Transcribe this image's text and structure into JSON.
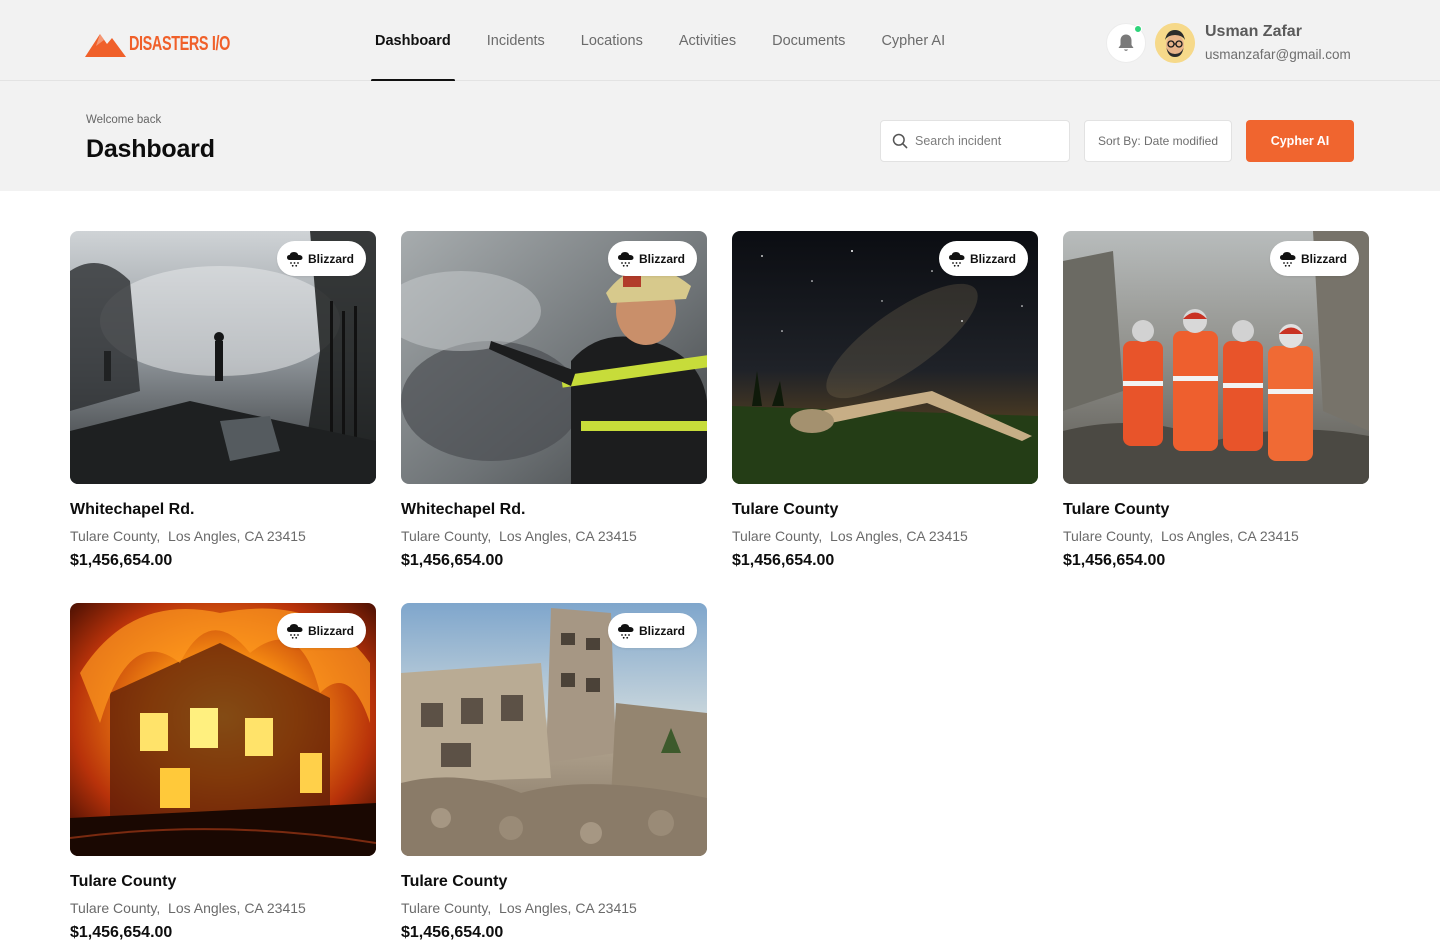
{
  "brand": {
    "name": "DISASTERS I/O",
    "color": "#f0602a"
  },
  "nav": {
    "items": [
      {
        "label": "Dashboard",
        "active": true
      },
      {
        "label": "Incidents",
        "active": false
      },
      {
        "label": "Locations",
        "active": false
      },
      {
        "label": "Activities",
        "active": false
      },
      {
        "label": "Documents",
        "active": false
      },
      {
        "label": "Cypher AI",
        "active": false
      }
    ]
  },
  "user": {
    "name": "Usman Zafar",
    "email": "usmanzafar@gmail.com",
    "notification_status_color": "#2ed47a"
  },
  "header": {
    "welcome": "Welcome back",
    "title": "Dashboard",
    "search_placeholder": "Search incident",
    "sort_label": "Sort By: Date modified",
    "cta_label": "Cypher AI",
    "cta_color": "#f0652f"
  },
  "cards": [
    {
      "title": "Whitechapel Rd.",
      "county": "Tulare County,",
      "city": "Los Angles, CA 23415",
      "amount": "$1,456,654.00",
      "badge": "Blizzard",
      "image": "smoke-ruins-firefighters"
    },
    {
      "title": "Whitechapel Rd.",
      "county": "Tulare County,",
      "city": "Los Angles, CA 23415",
      "amount": "$1,456,654.00",
      "badge": "Blizzard",
      "image": "firefighter-pointing"
    },
    {
      "title": "Tulare County",
      "county": "Tulare County,",
      "city": "Los Angles, CA 23415",
      "amount": "$1,456,654.00",
      "badge": "Blizzard",
      "image": "plane-wreck-night"
    },
    {
      "title": "Tulare County",
      "county": "Tulare County,",
      "city": "Los Angles, CA 23415",
      "amount": "$1,456,654.00",
      "badge": "Blizzard",
      "image": "rescue-team-rubble"
    },
    {
      "title": "Tulare County",
      "county": "Tulare County,",
      "city": "Los Angles, CA 23415",
      "amount": "$1,456,654.00",
      "badge": "Blizzard",
      "image": "house-fire"
    },
    {
      "title": "Tulare County",
      "county": "Tulare County,",
      "city": "Los Angles, CA 23415",
      "amount": "$1,456,654.00",
      "badge": "Blizzard",
      "image": "destroyed-building"
    }
  ]
}
